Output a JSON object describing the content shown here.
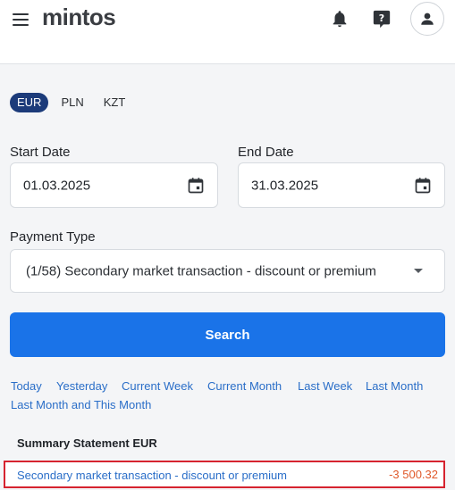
{
  "header": {
    "logo": "mintos",
    "icons": [
      "menu-icon",
      "bell-icon",
      "help-icon",
      "user-icon"
    ]
  },
  "currency_tabs": [
    {
      "label": "EUR",
      "active": true
    },
    {
      "label": "PLN",
      "active": false
    },
    {
      "label": "KZT",
      "active": false
    }
  ],
  "filters": {
    "start_date_label": "Start Date",
    "start_date_value": "01.03.2025",
    "end_date_label": "End Date",
    "end_date_value": "31.03.2025",
    "payment_type_label": "Payment Type",
    "payment_type_value": "(1/58) Secondary market transaction - discount or premium"
  },
  "search_button": "Search",
  "quick_ranges": [
    "Today",
    "Yesterday",
    "Current Week",
    "Current Month",
    "Last Week",
    "Last Month",
    "Last Month and This Month"
  ],
  "summary": {
    "title": "Summary Statement EUR",
    "rows": [
      {
        "name": "Secondary market transaction - discount or premium",
        "amount": "-3 500.32"
      }
    ]
  },
  "colors": {
    "primary": "#1a73e8",
    "tab_active": "#1c3b7a",
    "link": "#2a6ec8",
    "negative_amount": "#e0592a",
    "highlight_border": "#d6232f"
  }
}
